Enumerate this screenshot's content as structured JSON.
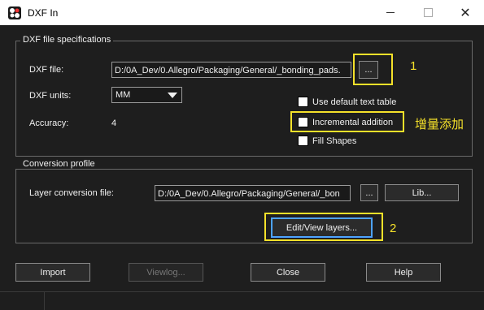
{
  "window": {
    "title": "DXF In",
    "minimize_icon": "minimize-icon",
    "maximize_icon": "maximize-icon",
    "close_icon": "close-icon"
  },
  "specs": {
    "group_label": "DXF file specifications",
    "dxf_file_label": "DXF file:",
    "dxf_file_value": "D:/0A_Dev/0.Allegro/Packaging/General/_bonding_pads.",
    "browse_label": "...",
    "units_label": "DXF units:",
    "units_value": "MM",
    "accuracy_label": "Accuracy:",
    "accuracy_value": "4",
    "use_default_text_table": "Use default text table",
    "incremental_addition": "Incremental addition",
    "fill_shapes": "Fill Shapes"
  },
  "profile": {
    "group_label": "Conversion profile",
    "layer_file_label": "Layer conversion file:",
    "layer_file_value": "D:/0A_Dev/0.Allegro/Packaging/General/_bon",
    "browse_label": "...",
    "lib_label": "Lib...",
    "edit_view_label": "Edit/View layers..."
  },
  "footer": {
    "import_label": "Import",
    "viewlog_label": "Viewlog...",
    "close_label": "Close",
    "help_label": "Help"
  },
  "annotations": {
    "one": "1",
    "cn": "增量添加",
    "two": "2",
    "highlight_color": "#f5e12a"
  }
}
